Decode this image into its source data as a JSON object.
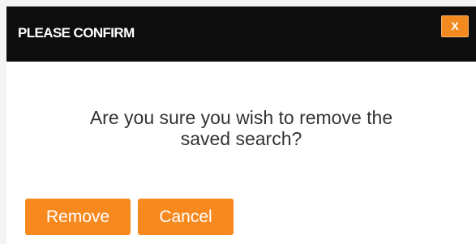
{
  "dialog": {
    "title": "PLEASE CONFIRM",
    "close_label": "X",
    "message_line1": "Are you sure you wish to remove the",
    "message_line2": "saved search?",
    "remove_label": "Remove",
    "cancel_label": "Cancel"
  },
  "colors": {
    "titlebar_bg": "#0d0d0d",
    "accent": "#f7891f",
    "message_text": "#333333"
  }
}
